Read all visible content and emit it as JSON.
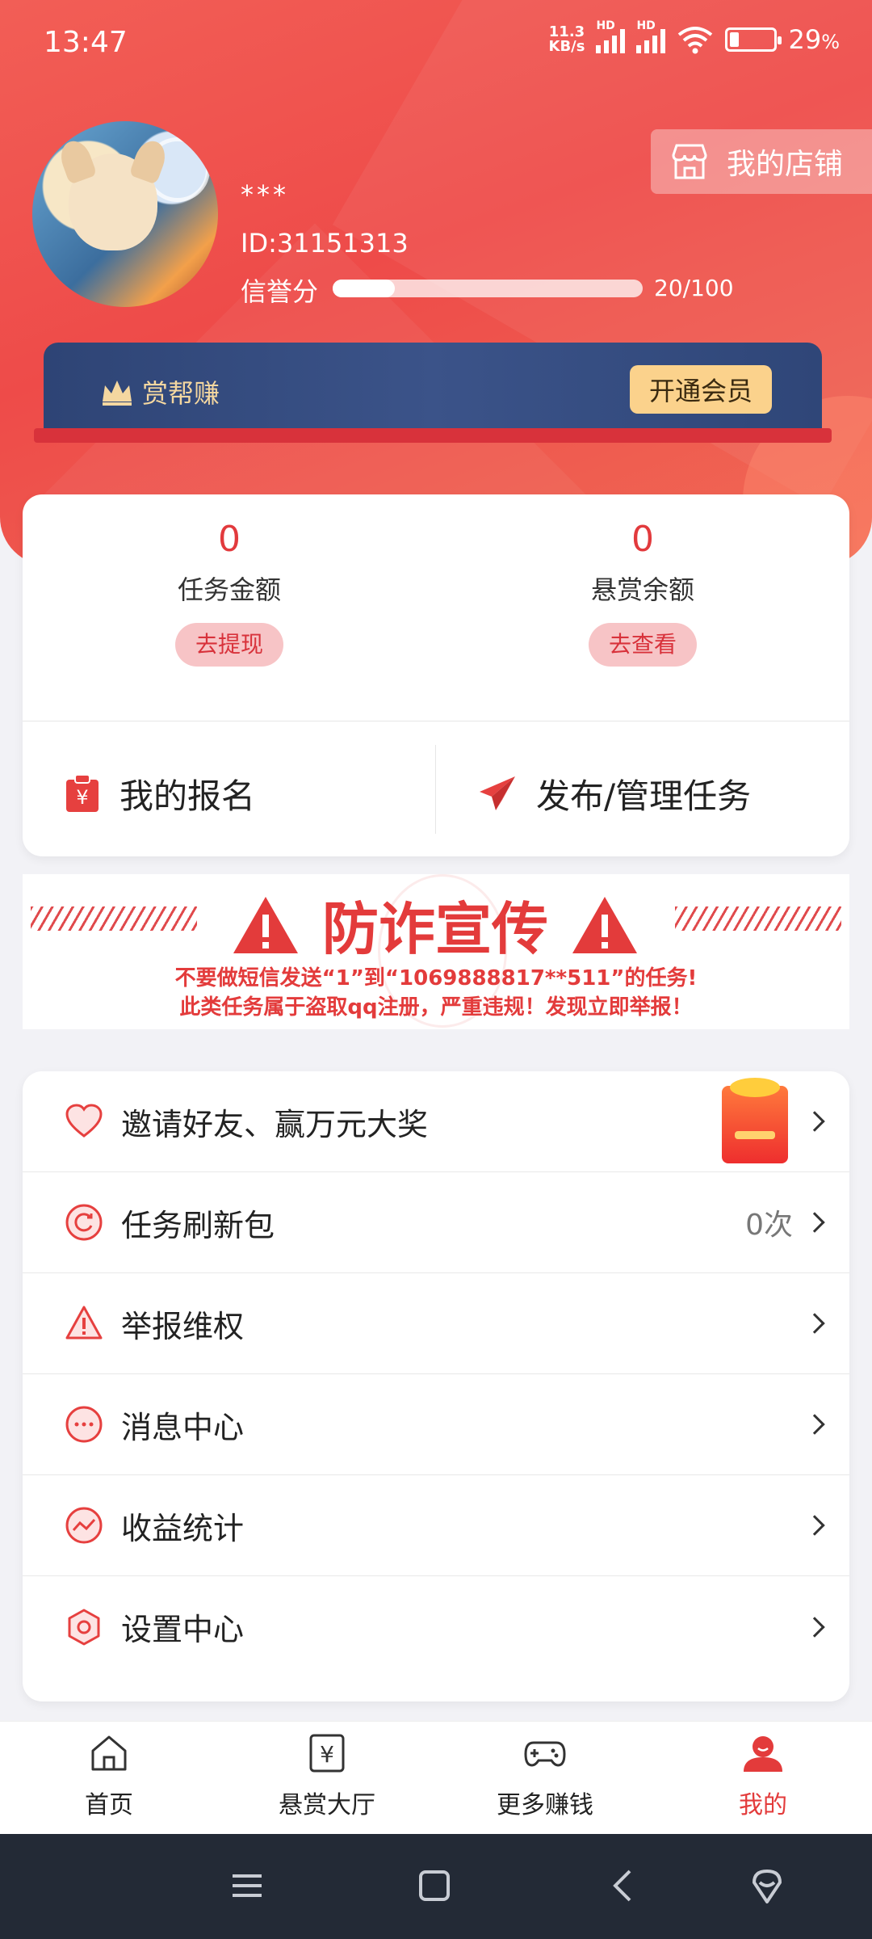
{
  "status_bar": {
    "time": "13:47",
    "net_speed_value": "11.3",
    "net_speed_unit": "KB/s",
    "battery_percent": "29",
    "battery_unit": "%",
    "battery_level": 0.29
  },
  "profile": {
    "name": "***",
    "id_text": "ID:31151313",
    "credit_label": "信誉分",
    "credit_value_text": "20/100",
    "credit_fraction": 0.2
  },
  "shop_button": {
    "label": "我的店铺"
  },
  "vip": {
    "title": "赏帮赚",
    "button_label": "开通会员"
  },
  "balance": {
    "task_amount": {
      "value": "0",
      "label": "任务金额",
      "action": "去提现"
    },
    "reward_balance": {
      "value": "0",
      "label": "悬赏余额",
      "action": "去查看"
    }
  },
  "actions": {
    "my_signups": "我的报名",
    "publish_manage": "发布/管理任务"
  },
  "fraud_banner": {
    "title": "防诈宣传",
    "line1": "不要做短信发送“1”到“1069888817**511”的任务!",
    "line2": "此类任务属于盗取qq注册，严重违规！发现立即举报！"
  },
  "menu": [
    {
      "label": "邀请好友、赢万元大奖",
      "icon": "heart-icon",
      "right": ""
    },
    {
      "label": "任务刷新包",
      "icon": "refresh-icon",
      "right": "0次"
    },
    {
      "label": "举报维权",
      "icon": "warning-icon",
      "right": ""
    },
    {
      "label": "消息中心",
      "icon": "message-icon",
      "right": ""
    },
    {
      "label": "收益统计",
      "icon": "trend-icon",
      "right": ""
    },
    {
      "label": "设置中心",
      "icon": "settings-icon",
      "right": ""
    }
  ],
  "tabs": [
    {
      "label": "首页",
      "icon": "home-icon"
    },
    {
      "label": "悬赏大厅",
      "icon": "yuan-icon"
    },
    {
      "label": "更多赚钱",
      "icon": "gamepad-icon"
    },
    {
      "label": "我的",
      "icon": "profile-icon",
      "active": true
    }
  ],
  "colors": {
    "brand_red": "#e33b3b",
    "vip_navy": "#3b5389",
    "vip_gold": "#fbd28c"
  }
}
